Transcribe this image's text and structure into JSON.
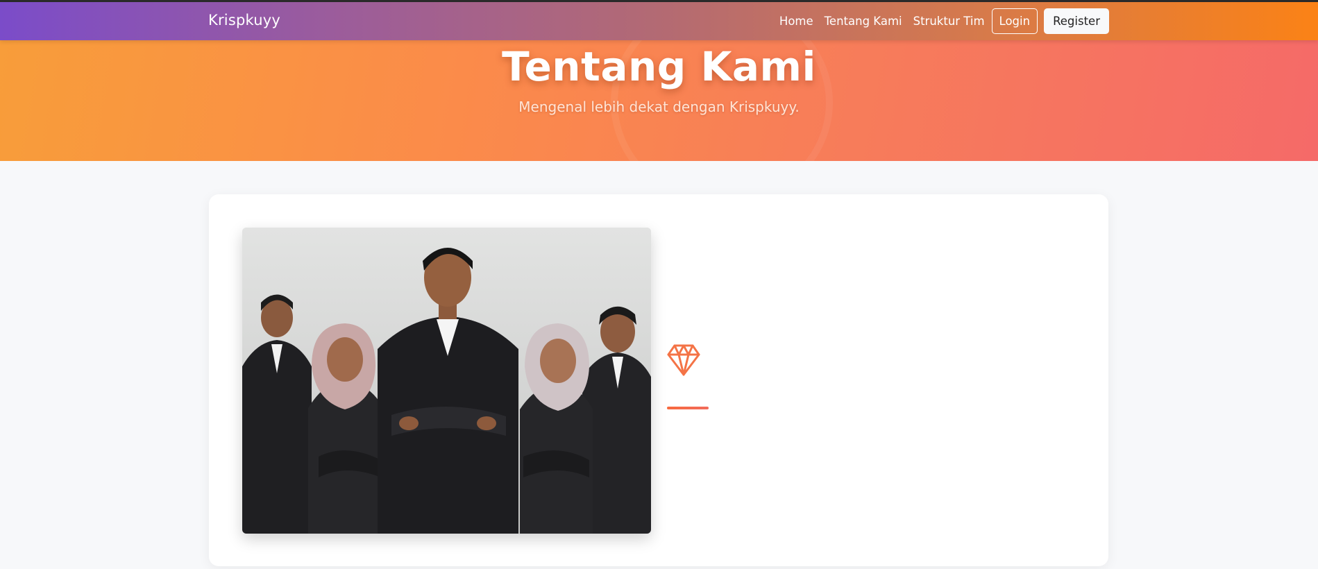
{
  "navbar": {
    "brand": "Krispkuyy",
    "links": [
      "Home",
      "Tentang Kami",
      "Struktur Tim"
    ],
    "login_label": "Login",
    "register_label": "Register"
  },
  "hero": {
    "title": "Tentang Kami",
    "subtitle": "Mengenal lebih dekat dengan Krispkuyy."
  },
  "about": {
    "photo_subject": "team-photo",
    "icon": "gem-icon",
    "accent_color": "#f7693d"
  },
  "colors": {
    "nav_start": "#7b4cc9",
    "nav_end": "#fb8216",
    "hero_start": "#f89d3a",
    "hero_end": "#f56a68"
  }
}
